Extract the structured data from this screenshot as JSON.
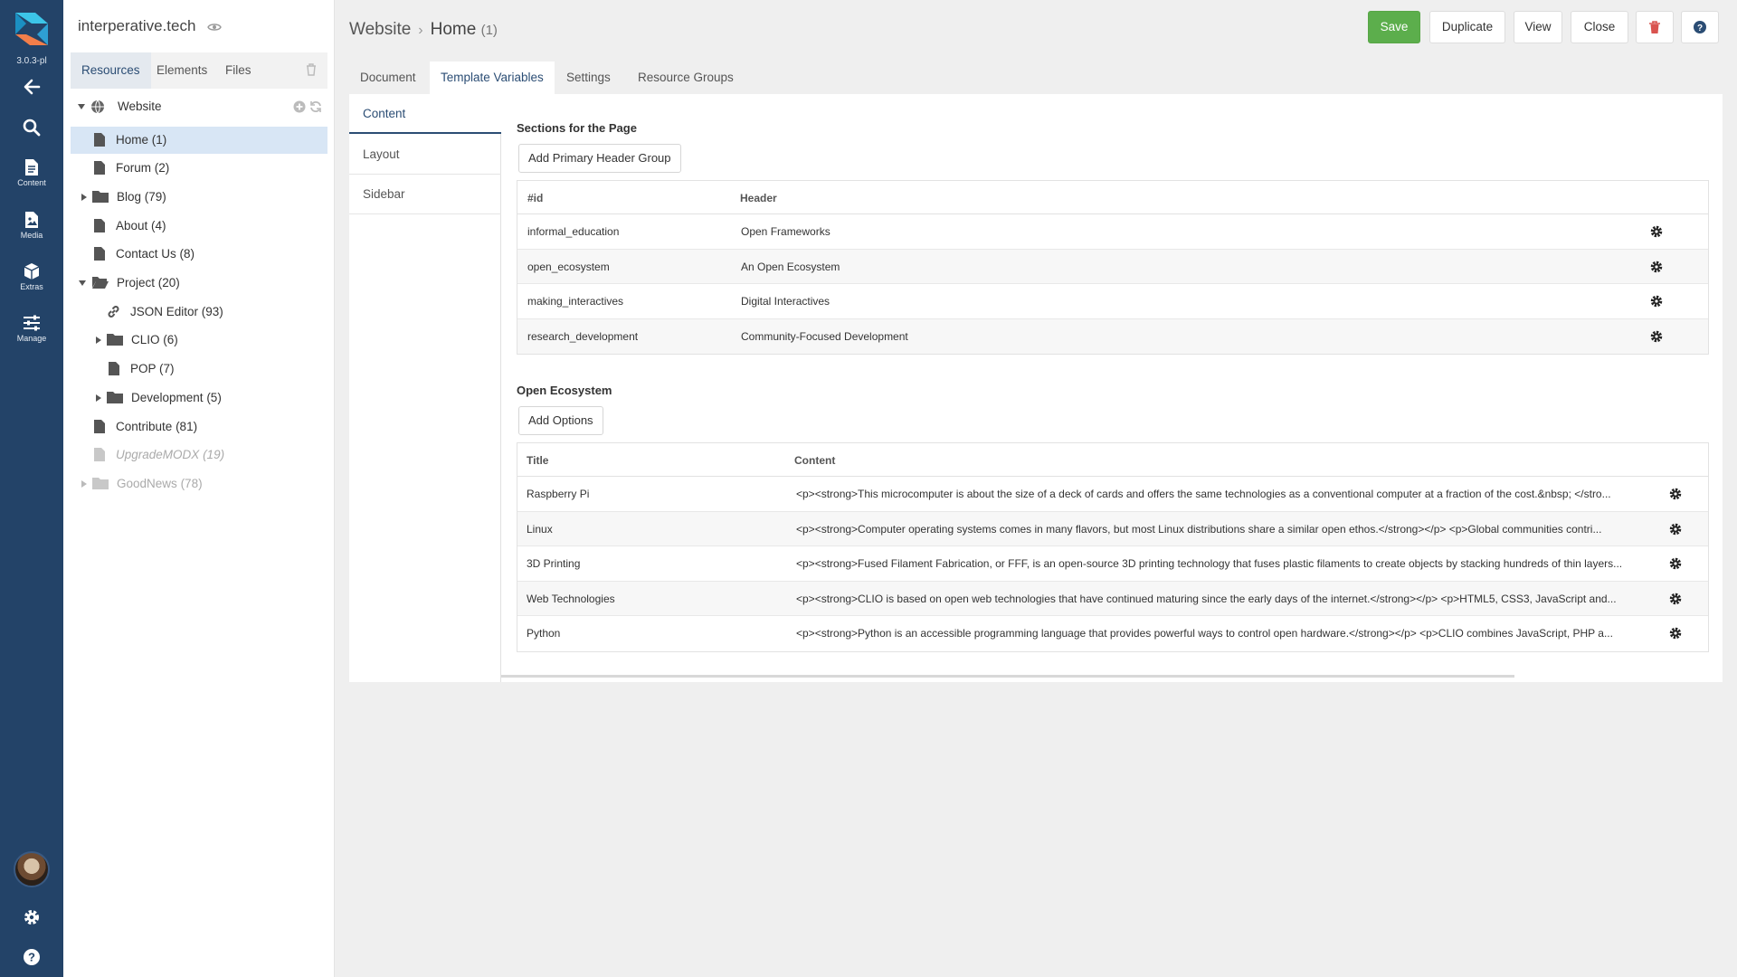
{
  "app": {
    "version": "3.0.3-pl",
    "nav": {
      "content": "Content",
      "media": "Media",
      "extras": "Extras",
      "manage": "Manage"
    }
  },
  "tree": {
    "site_name": "interperative.tech",
    "tabs": [
      "Resources",
      "Elements",
      "Files"
    ],
    "root": "Website",
    "items": [
      {
        "label": "Home",
        "count": "(1)"
      },
      {
        "label": "Forum",
        "count": "(2)"
      },
      {
        "label": "Blog",
        "count": "(79)"
      },
      {
        "label": "About",
        "count": "(4)"
      },
      {
        "label": "Contact Us",
        "count": "(8)"
      },
      {
        "label": "Project",
        "count": "(20)"
      },
      {
        "label": "JSON Editor",
        "count": "(93)"
      },
      {
        "label": "CLIO",
        "count": "(6)"
      },
      {
        "label": "POP",
        "count": "(7)"
      },
      {
        "label": "Development",
        "count": "(5)"
      },
      {
        "label": "Contribute",
        "count": "(81)"
      },
      {
        "label": "UpgradeMODX",
        "count": "(19)"
      },
      {
        "label": "GoodNews",
        "count": "(78)"
      }
    ]
  },
  "header": {
    "crumb_parent": "Website",
    "crumb_current": "Home",
    "crumb_id": "(1)"
  },
  "actions": {
    "save": "Save",
    "duplicate": "Duplicate",
    "view": "View",
    "close": "Close"
  },
  "tabs": [
    "Document",
    "Template Variables",
    "Settings",
    "Resource Groups"
  ],
  "vtabs": [
    "Content",
    "Layout",
    "Sidebar"
  ],
  "sections": {
    "title": "Sections for the Page",
    "add_button": "Add Primary Header Group",
    "columns": [
      "#id",
      "Header"
    ],
    "rows": [
      {
        "id": "informal_education",
        "header": "Open Frameworks"
      },
      {
        "id": "open_ecosystem",
        "header": "An Open Ecosystem"
      },
      {
        "id": "making_interactives",
        "header": "Digital Interactives"
      },
      {
        "id": "research_development",
        "header": "Community-Focused Development"
      }
    ]
  },
  "ecosystem": {
    "title": "Open Ecosystem",
    "add_button": "Add Options",
    "columns": [
      "Title",
      "Content"
    ],
    "rows": [
      {
        "title": "Raspberry Pi",
        "content": "<p><strong>This microcomputer is about the size of a deck of cards and offers the same technologies as a conventional computer at a fraction of the cost.&nbsp; </stro..."
      },
      {
        "title": "Linux",
        "content": "<p><strong>Computer operating systems comes in many flavors, but most Linux distributions share a similar open ethos.</strong></p> <p>Global communities contri..."
      },
      {
        "title": "3D Printing",
        "content": "<p><strong>Fused Filament Fabrication, or FFF, is an open-source 3D printing technology that fuses plastic filaments to create objects by stacking hundreds of thin layers..."
      },
      {
        "title": "Web Technologies",
        "content": "<p><strong>CLIO is based on open web technologies that have continued maturing since the early days of the internet.</strong></p> <p>HTML5, CSS3, JavaScript and..."
      },
      {
        "title": "Python",
        "content": "<p><strong>Python is an accessible programming language that provides powerful ways to control open hardware.</strong></p> <p>CLIO combines JavaScript, PHP a..."
      }
    ]
  },
  "colors": {
    "sidebar": "#234368",
    "accent": "#2b4d74",
    "save": "#5cae4c",
    "delete": "#d9534f"
  }
}
